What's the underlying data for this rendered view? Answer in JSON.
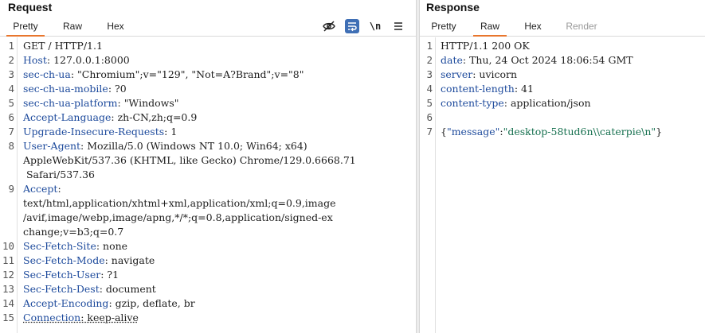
{
  "request": {
    "title": "Request",
    "tabs": [
      {
        "label": "Pretty",
        "active": true
      },
      {
        "label": "Raw",
        "active": false
      },
      {
        "label": "Hex",
        "active": false
      }
    ],
    "toolbar": {
      "hide_icon": "eye-slash-icon",
      "wrap_icon": "word-wrap-icon",
      "newline_label": "\\n",
      "menu_icon": "hamburger-menu-icon"
    },
    "line_numbers": [
      "1",
      "2",
      "3",
      "4",
      "5",
      "6",
      "7",
      "8",
      "9",
      "10",
      "11",
      "12",
      "13",
      "14",
      "15"
    ],
    "request_line": "GET / HTTP/1.1",
    "headers": [
      {
        "name": "Host",
        "value": "127.0.0.1:8000"
      },
      {
        "name": "sec-ch-ua",
        "value": "\"Chromium\";v=\"129\", \"Not=A?Brand\";v=\"8\""
      },
      {
        "name": "sec-ch-ua-mobile",
        "value": "?0"
      },
      {
        "name": "sec-ch-ua-platform",
        "value": "\"Windows\""
      },
      {
        "name": "Accept-Language",
        "value": "zh-CN,zh;q=0.9"
      },
      {
        "name": "Upgrade-Insecure-Requests",
        "value": "1"
      },
      {
        "name": "User-Agent",
        "value": "Mozilla/5.0 (Windows NT 10.0; Win64; x64)",
        "continuation": [
          "AppleWebKit/537.36 (KHTML, like Gecko) Chrome/129.0.6668.71",
          " Safari/537.36"
        ]
      },
      {
        "name": "Accept",
        "value": "",
        "continuation": [
          "text/html,application/xhtml+xml,application/xml;q=0.9,image",
          "/avif,image/webp,image/apng,*/*;q=0.8,application/signed-ex",
          "change;v=b3;q=0.7"
        ]
      },
      {
        "name": "Sec-Fetch-Site",
        "value": "none"
      },
      {
        "name": "Sec-Fetch-Mode",
        "value": "navigate"
      },
      {
        "name": "Sec-Fetch-User",
        "value": "?1"
      },
      {
        "name": "Sec-Fetch-Dest",
        "value": "document"
      },
      {
        "name": "Accept-Encoding",
        "value": "gzip, deflate, br"
      },
      {
        "name": "Connection",
        "value": "keep-alive"
      }
    ]
  },
  "response": {
    "title": "Response",
    "tabs": [
      {
        "label": "Pretty",
        "active": false
      },
      {
        "label": "Raw",
        "active": true
      },
      {
        "label": "Hex",
        "active": false
      },
      {
        "label": "Render",
        "active": false,
        "disabled": true
      }
    ],
    "line_numbers": [
      "1",
      "2",
      "3",
      "4",
      "5",
      "6",
      "7"
    ],
    "status_line": "HTTP/1.1 200 OK",
    "headers": [
      {
        "name": "date",
        "value": "Thu, 24 Oct 2024 18:06:54 GMT"
      },
      {
        "name": "server",
        "value": "uvicorn"
      },
      {
        "name": "content-length",
        "value": "41"
      },
      {
        "name": "content-type",
        "value": "application/json"
      }
    ],
    "body": {
      "open": "{",
      "key": "\"message\"",
      "colon": ":",
      "value": "\"desktop-58tud6n\\\\caterpie\\n\"",
      "close": "}"
    }
  },
  "colors": {
    "accent": "#e8762d",
    "header_name": "#1d4a9c",
    "json_string": "#16704f",
    "wrap_icon_bg": "#3f6fb5"
  }
}
